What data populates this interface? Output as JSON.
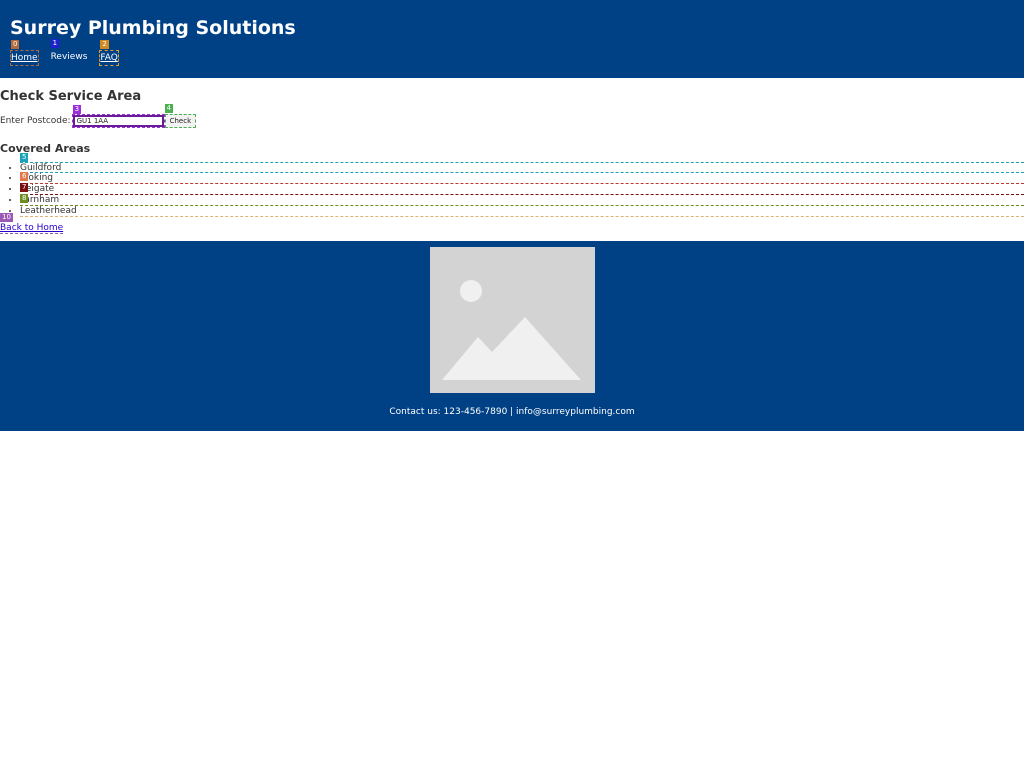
{
  "header": {
    "title": "Surrey Plumbing Solutions",
    "nav": [
      {
        "label": "Home",
        "badge": "0",
        "badge_color": "#b36a3a"
      },
      {
        "label": "Reviews",
        "badge": "1",
        "badge_color": "#2020d0"
      },
      {
        "label": "FAQ",
        "badge": "2",
        "badge_color": "#d08a20"
      }
    ]
  },
  "main": {
    "title": "Check Service Area",
    "postcode_label": "Enter Postcode:",
    "postcode_value": "GU1 1AA",
    "postcode_badge": "3",
    "postcode_badge_color": "#9b30d9",
    "check_label": "Check",
    "check_badge": "4",
    "check_badge_color": "#4caf50",
    "covered_title": "Covered Areas",
    "areas": [
      {
        "name": "Guildford",
        "badge": "5",
        "badge_color": "#17a2b8"
      },
      {
        "name": "Woking",
        "badge": "6",
        "badge_color": "#e07a4a"
      },
      {
        "name": "Reigate",
        "badge": "7",
        "badge_color": "#7a1010"
      },
      {
        "name": "Farnham",
        "badge": "8",
        "badge_color": "#6b8e23"
      },
      {
        "name": "Leatherhead",
        "badge": "9",
        "badge_color": "#e0b070"
      }
    ],
    "back_label": "Back to Home",
    "back_badge": "10",
    "back_badge_color": "#9b59b6"
  },
  "footer": {
    "image_icon": "image-placeholder-icon",
    "contact": "Contact us: 123-456-7890 | info@surreyplumbing.com"
  },
  "colors": {
    "brand": "#004085",
    "placeholder_bg": "#d3d3d3",
    "placeholder_fg": "#f0f0f0"
  }
}
